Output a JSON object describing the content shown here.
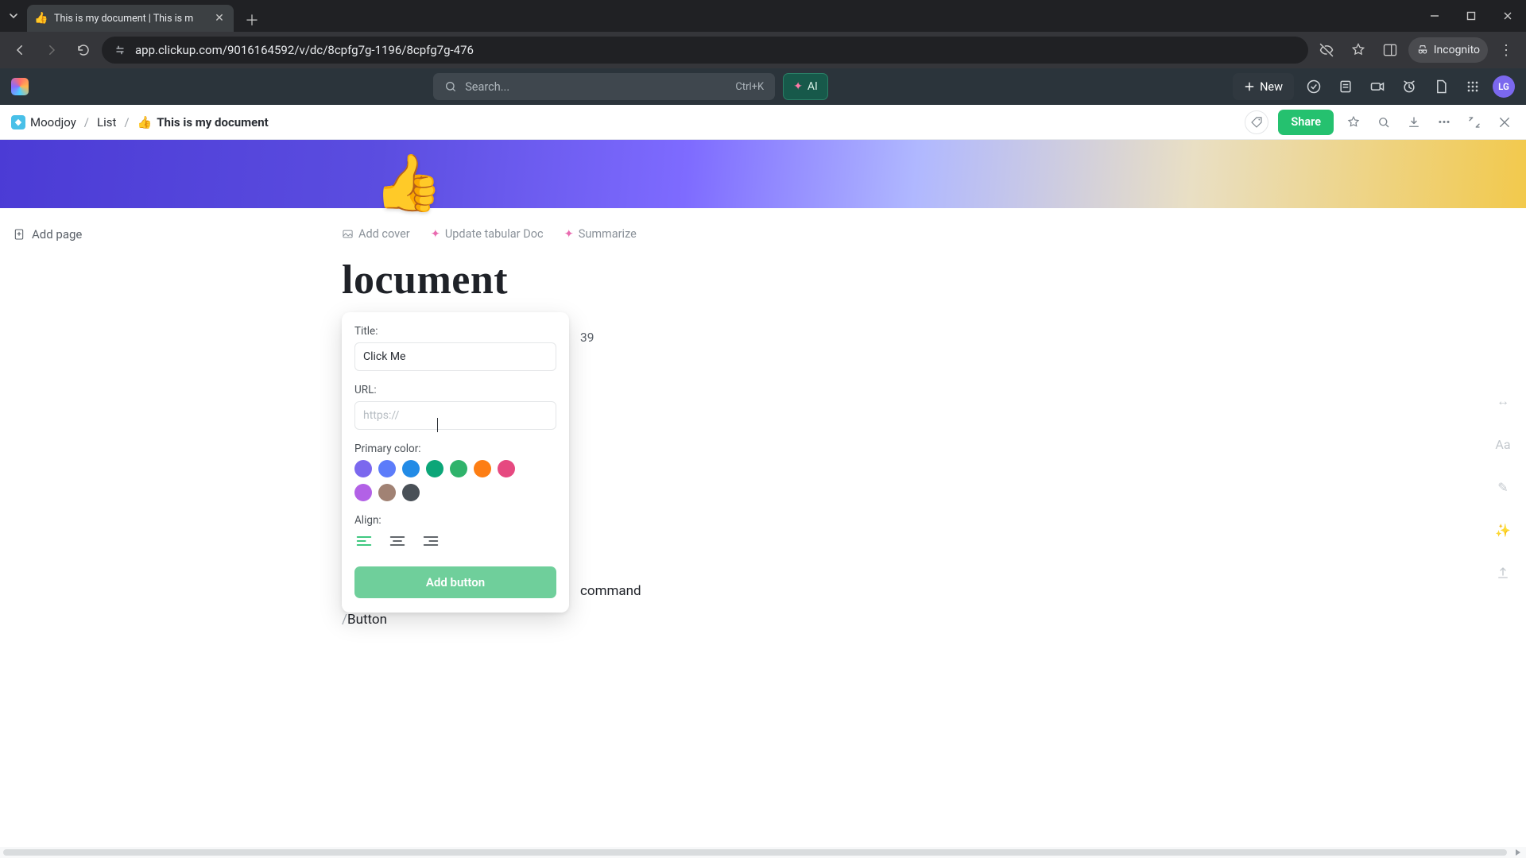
{
  "browser": {
    "tab_title": "This is my document | This is m",
    "tab_emoji": "👍",
    "url": "app.clickup.com/9016164592/v/dc/8cpfg7g-1196/8cpfg7g-476",
    "incognito_label": "Incognito"
  },
  "app_header": {
    "search_placeholder": "Search...",
    "search_shortcut": "Ctrl+K",
    "ai_label": "AI",
    "new_label": "New",
    "avatar_initials": "LG"
  },
  "breadcrumbs": {
    "workspace": "Moodjoy",
    "list": "List",
    "doc_emoji": "👍",
    "doc_name": "This is my document",
    "share_label": "Share"
  },
  "doc": {
    "emoji": "👍",
    "add_page_label": "Add page",
    "sub_actions": {
      "add_cover": "Add cover",
      "update": "Update tabular Doc",
      "summarize": "Summarize"
    },
    "title": "locument",
    "time_fragment": "39",
    "command_fragment": "command",
    "slash_prefix": "/",
    "slash_text": "Button"
  },
  "popover": {
    "title_label": "Title:",
    "title_value": "Click Me",
    "url_label": "URL:",
    "url_placeholder": "https://",
    "primary_color_label": "Primary color:",
    "colors": [
      "#7b68ee",
      "#5c7cfa",
      "#228be6",
      "#0ca678",
      "#2fb36b",
      "#fd7e14",
      "#e64980",
      "#b261e6",
      "#a18274",
      "#495057"
    ],
    "align_label": "Align:",
    "submit_label": "Add button"
  }
}
